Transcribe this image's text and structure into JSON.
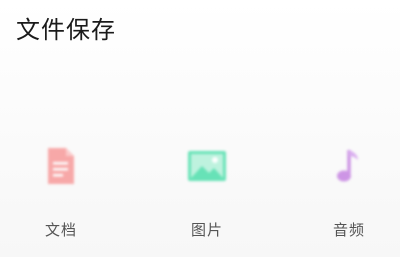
{
  "header": {
    "title": "文件保存"
  },
  "categories": [
    {
      "label": "文档",
      "icon": "document-icon",
      "color": "#f48a8a"
    },
    {
      "label": "图片",
      "icon": "image-icon",
      "color": "#4fd9a6"
    },
    {
      "label": "音频",
      "icon": "music-note-icon",
      "color": "#c98be3"
    }
  ]
}
